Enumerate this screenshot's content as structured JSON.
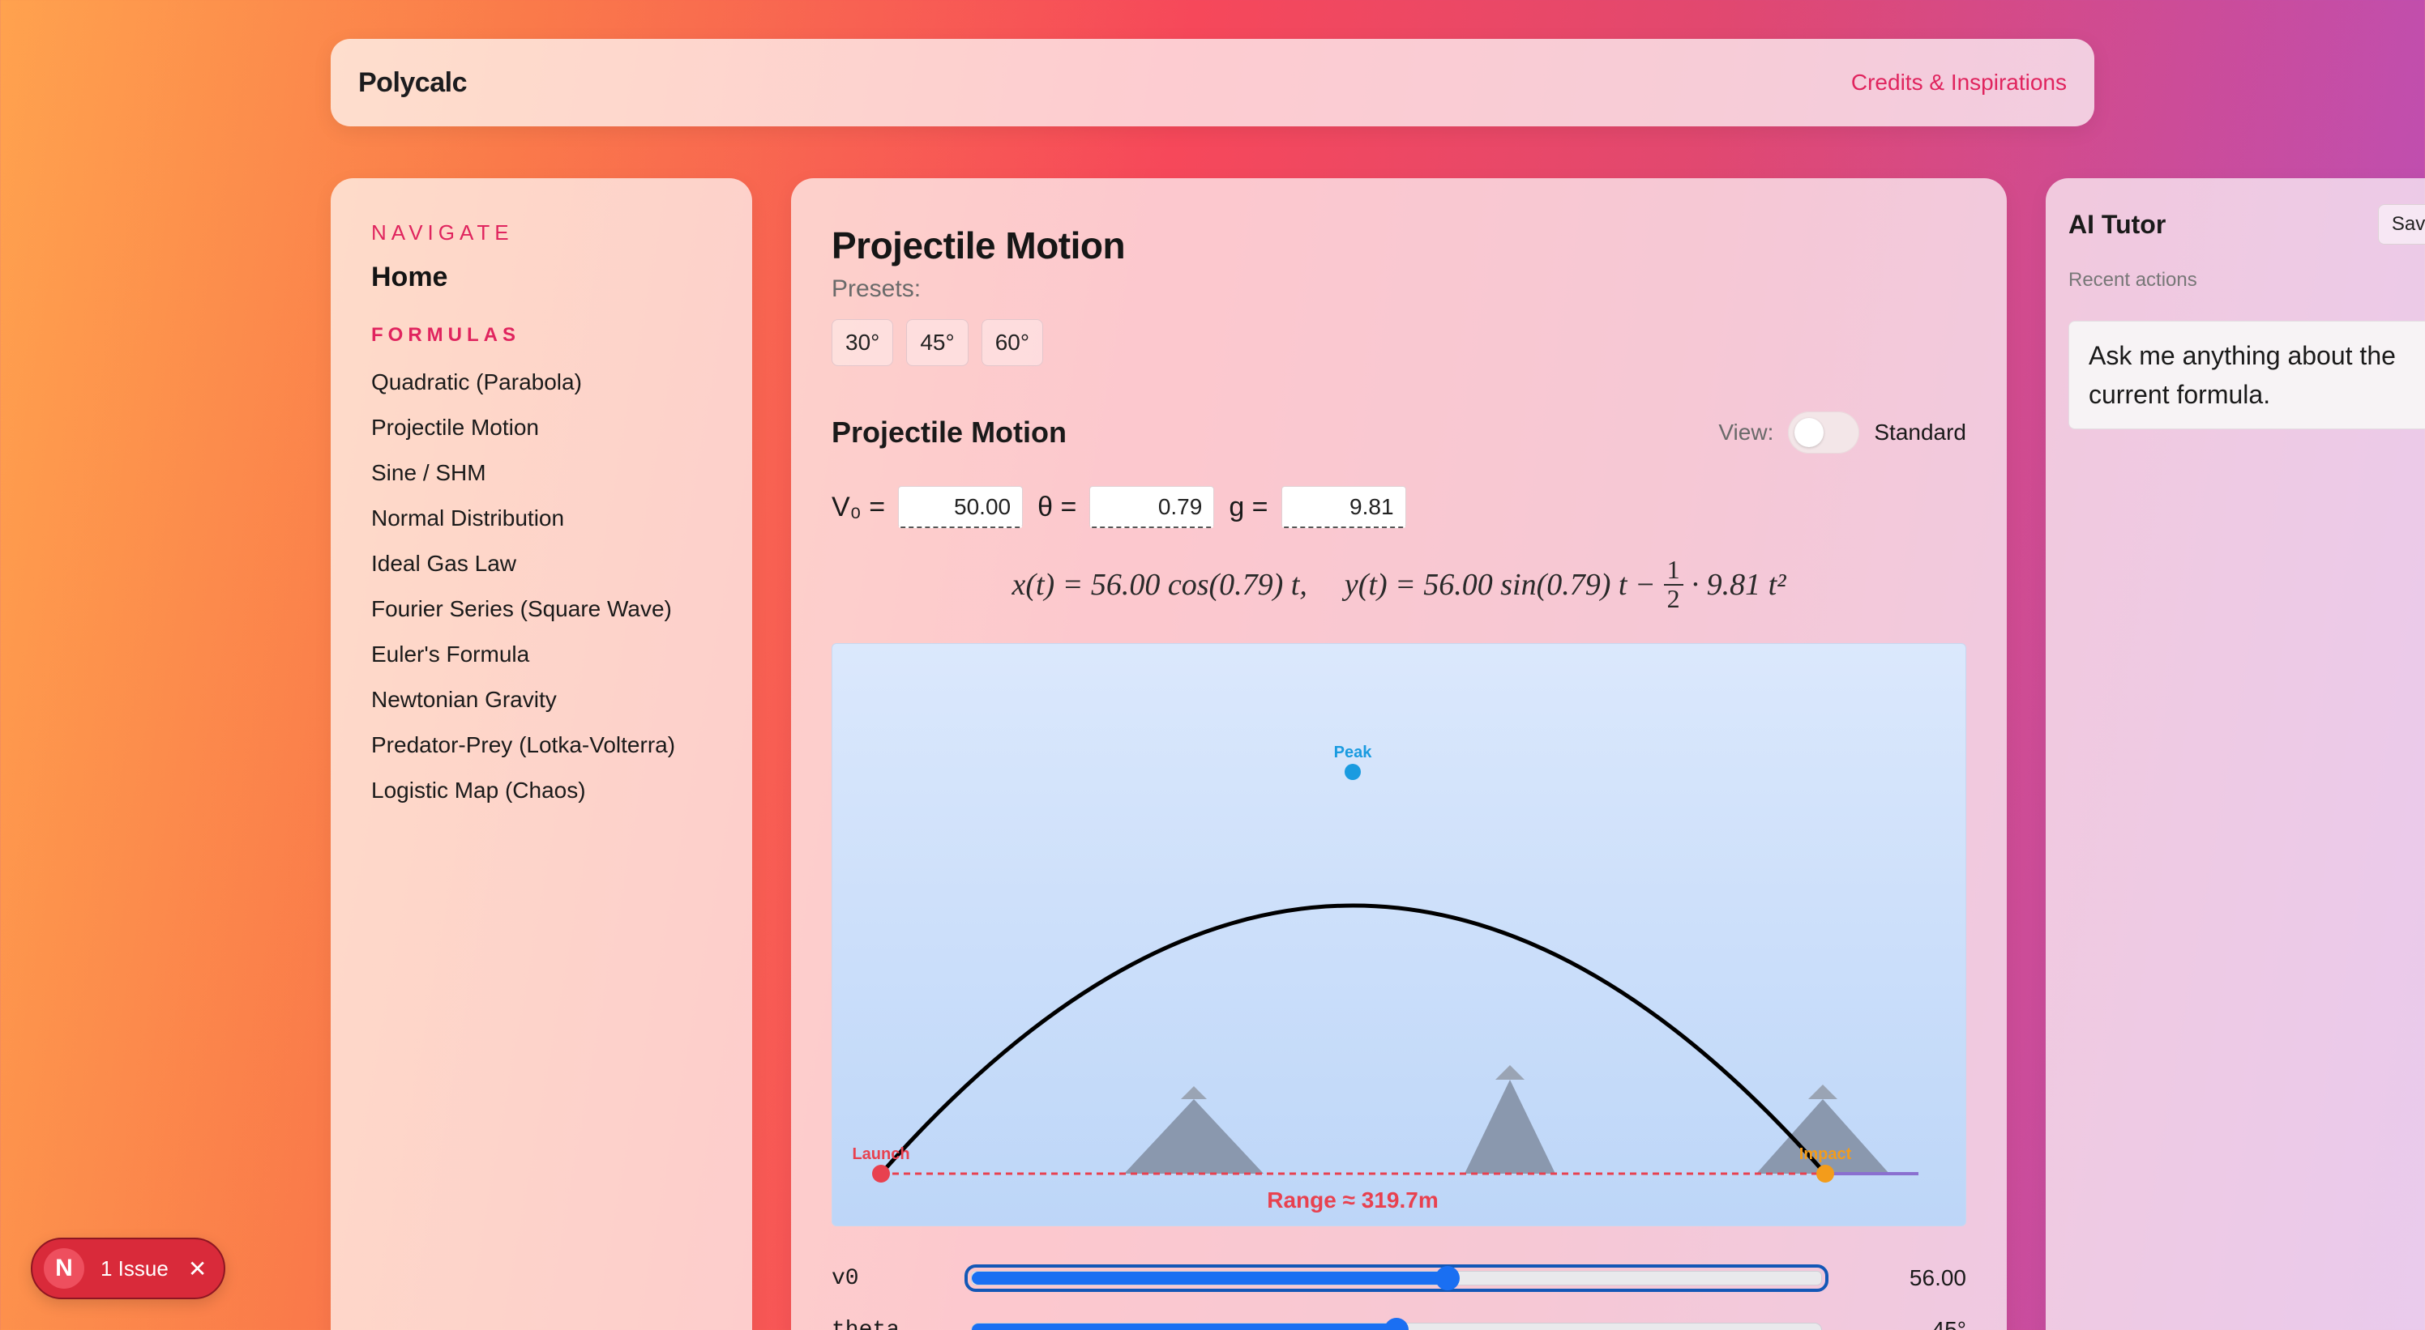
{
  "header": {
    "brand": "Polycalc",
    "credits": "Credits & Inspirations"
  },
  "sidebar": {
    "navigate_heading": "NAVIGATE",
    "home": "Home",
    "formulas_heading": "FORMULAS",
    "items": [
      {
        "label": "Quadratic (Parabola)"
      },
      {
        "label": "Projectile Motion"
      },
      {
        "label": "Sine / SHM"
      },
      {
        "label": "Normal Distribution"
      },
      {
        "label": "Ideal Gas Law"
      },
      {
        "label": "Fourier Series (Square Wave)"
      },
      {
        "label": "Euler's Formula"
      },
      {
        "label": "Newtonian Gravity"
      },
      {
        "label": "Predator-Prey (Lotka-Volterra)"
      },
      {
        "label": "Logistic Map (Chaos)"
      }
    ]
  },
  "main": {
    "title": "Projectile Motion",
    "presets_label": "Presets:",
    "presets": [
      "30°",
      "45°",
      "60°"
    ],
    "section_title": "Projectile Motion",
    "view_label": "View:",
    "view_mode": "Standard",
    "params": {
      "v0_label": "V₀ =",
      "v0_value": "50.00",
      "theta_label": "θ =",
      "theta_value": "0.79",
      "g_label": "g =",
      "g_value": "9.81"
    },
    "equation": {
      "x_part": "x(t) = 56.00 cos(0.79) t,",
      "y_part": "y(t) = 56.00 sin(0.79) t −",
      "frac_num": "1",
      "frac_den": "2",
      "y_tail": "· 9.81 t²"
    },
    "plot": {
      "peak_label": "Peak",
      "launch_label": "Launch",
      "impact_label": "Impact",
      "range_label": "Range ≈ 319.7m",
      "range_m": 319.7,
      "colors": {
        "trajectory": "#000000",
        "peak": "#1a9be0",
        "launch": "#e8414f",
        "impact": "#f39c1b",
        "ground": "#e8414f",
        "mountain": "#8a98ae"
      }
    },
    "sliders": [
      {
        "label": "v0",
        "value": "56.00",
        "fraction": 0.56
      },
      {
        "label": "theta",
        "value": "45°",
        "fraction": 0.5
      }
    ]
  },
  "tutor": {
    "title": "AI Tutor",
    "save_label": "Save preset",
    "recent_label": "Recent actions",
    "message": "Ask me anything about the current formula."
  },
  "issue_badge": {
    "letter": "N",
    "text": "1 Issue"
  }
}
